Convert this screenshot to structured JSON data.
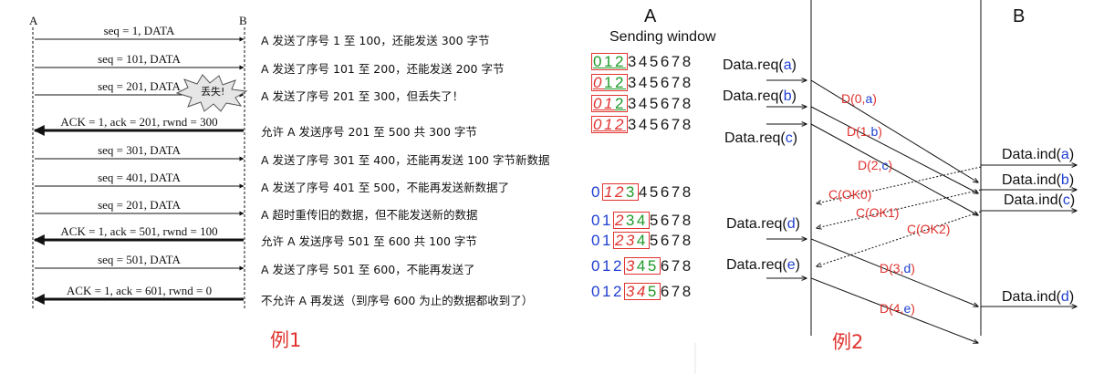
{
  "ex1": {
    "host_a": "A",
    "host_b": "B",
    "caption": "例1",
    "burst": "丢失!",
    "rows": [
      {
        "label": "seq = 1, DATA",
        "desc": "A 发送了序号 1 至 100，还能发送 300 字节"
      },
      {
        "label": "seq = 101, DATA",
        "desc": "A 发送了序号 101 至 200，还能发送 200 字节"
      },
      {
        "label": "seq = 201, DATA",
        "desc": "A 发送了序号 201 至 300，但丢失了！"
      },
      {
        "label": "ACK = 1, ack = 201, rwnd = 300",
        "desc": "允许 A 发送序号 201 至 500  共 300 字节"
      },
      {
        "label": "seq = 301, DATA",
        "desc": "A 发送了序号 301 至 400，还能再发送 100 字节新数据"
      },
      {
        "label": "seq = 401, DATA",
        "desc": "A 发送了序号 401 至 500，不能再发送新数据了"
      },
      {
        "label": "seq = 201, DATA",
        "desc": "A 超时重传旧的数据，但不能发送新的数据"
      },
      {
        "label": "ACK = 1, ack = 501, rwnd = 100",
        "desc": "允许 A 发送序号 501 至 600 共 100 字节"
      },
      {
        "label": "seq = 501, DATA",
        "desc": "A 发送了序号 501 至 600，不能再发送了"
      },
      {
        "label": "ACK = 1, ack = 601, rwnd = 0",
        "desc": "不允许 A 再发送（到序号 600 为止的数据都收到了）"
      }
    ]
  },
  "ex2": {
    "host_a": "A",
    "host_b": "B",
    "window_title": "Sending window",
    "caption": "例2",
    "windows": [
      "0",
      "1",
      "2",
      "3",
      "4",
      "5",
      "6",
      "7",
      "8"
    ],
    "data_req": {
      "prefix": "Data.req(",
      "suffix": ")",
      "args": [
        "a",
        "b",
        "c",
        "d",
        "e"
      ]
    },
    "data_ind": {
      "prefix": "Data.ind(",
      "suffix": ")",
      "args": [
        "a",
        "b",
        "c",
        "d"
      ]
    },
    "frames": [
      {
        "pre": "D(0,",
        "arg": "a",
        "post": ")"
      },
      {
        "pre": "D(1,",
        "arg": "b",
        "post": ")"
      },
      {
        "pre": "D(2,",
        "arg": "c",
        "post": ")"
      },
      {
        "pre": "D(3,",
        "arg": "d",
        "post": ")"
      },
      {
        "pre": "D(4,",
        "arg": "e",
        "post": ")"
      }
    ],
    "acks": [
      "C(OK0)",
      "C(OK1)",
      "C(OK2)"
    ],
    "colors": {
      "red": "#e0332f",
      "blue": "#1f3fd1",
      "green": "#1f9a2a"
    }
  }
}
